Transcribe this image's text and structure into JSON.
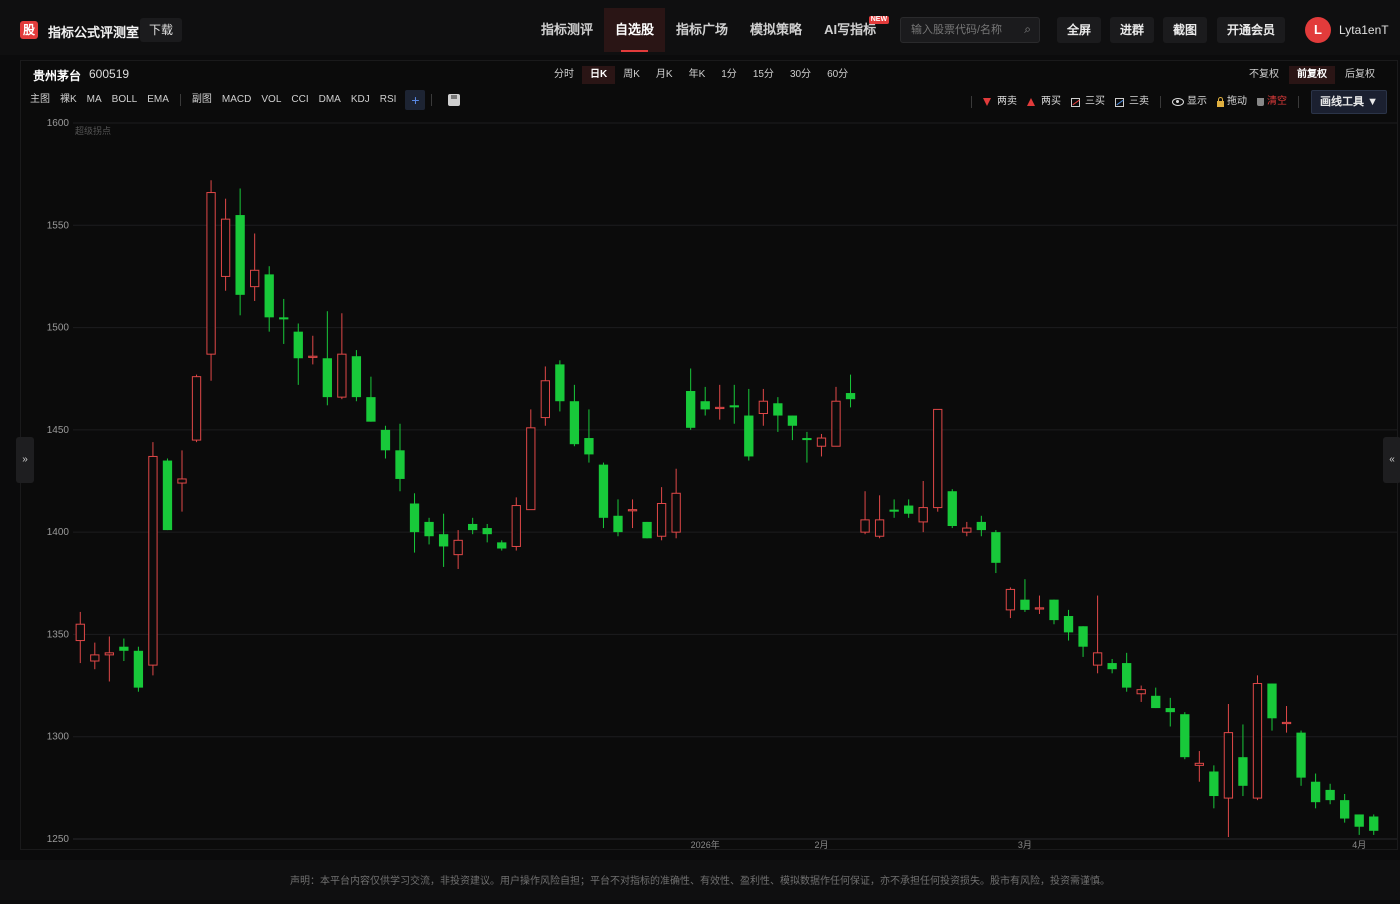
{
  "header": {
    "logo_char": "股",
    "app_title": "指标公式评测室",
    "download_label": "下载",
    "nav": [
      {
        "label": "指标测评",
        "active": false
      },
      {
        "label": "自选股",
        "active": true
      },
      {
        "label": "指标广场",
        "active": false
      },
      {
        "label": "模拟策略",
        "active": false
      },
      {
        "label": "AI写指标",
        "active": false
      }
    ],
    "new_badge": "NEW",
    "search_placeholder": "输入股票代码/名称",
    "buttons": {
      "fullscreen": "全屏",
      "join_group": "进群",
      "screenshot": "截图",
      "vip": "开通会员"
    },
    "user": {
      "avatar_initial": "L",
      "name": "Lyta1enT"
    }
  },
  "stock": {
    "name": "贵州茅台",
    "code": "600519"
  },
  "periods": [
    {
      "label": "分时",
      "active": false
    },
    {
      "label": "日K",
      "active": true
    },
    {
      "label": "周K",
      "active": false
    },
    {
      "label": "月K",
      "active": false
    },
    {
      "label": "年K",
      "active": false
    },
    {
      "label": "1分",
      "active": false
    },
    {
      "label": "15分",
      "active": false
    },
    {
      "label": "30分",
      "active": false
    },
    {
      "label": "60分",
      "active": false
    }
  ],
  "adjust": [
    {
      "label": "不复权",
      "active": false
    },
    {
      "label": "前复权",
      "active": true
    },
    {
      "label": "后复权",
      "active": false
    }
  ],
  "main_indicators": [
    "主图",
    "裸K",
    "MA",
    "BOLL",
    "EMA"
  ],
  "sub_indicators": [
    "副图",
    "MACD",
    "VOL",
    "CCI",
    "DMA",
    "KDJ",
    "RSI"
  ],
  "plus_label": "+",
  "draw_tools": {
    "two_sell": "两卖",
    "two_buy": "两买",
    "three_buy": "三买",
    "three_sell": "三卖",
    "show": "显示",
    "drag": "拖动",
    "clear": "清空",
    "draw_tool_btn": "画线工具 ▼"
  },
  "colors": {
    "up": "#e04848",
    "down": "#18c93a",
    "grid": "#1d1d1f",
    "accent": "#e23b3b"
  },
  "chart_data": {
    "type": "candlestick",
    "annotation": "超级拐点",
    "ylim": [
      1250,
      1600
    ],
    "yticks": [
      1250,
      1300,
      1350,
      1400,
      1450,
      1500,
      1550,
      1600
    ],
    "xlabels": [
      {
        "index": 43,
        "label": "2026年"
      },
      {
        "index": 51,
        "label": "2月"
      },
      {
        "index": 65,
        "label": "3月"
      },
      {
        "index": 88,
        "label": "4月"
      }
    ],
    "candles": [
      [
        1347,
        1355,
        1336,
        1361
      ],
      [
        1337,
        1340,
        1333,
        1346
      ],
      [
        1340,
        1341,
        1327,
        1349
      ],
      [
        1344,
        1342,
        1337,
        1348
      ],
      [
        1342,
        1324,
        1322,
        1344
      ],
      [
        1335,
        1437,
        1330,
        1444
      ],
      [
        1435,
        1401,
        1401,
        1436
      ],
      [
        1424,
        1426,
        1410,
        1440
      ],
      [
        1445,
        1476,
        1444,
        1477
      ],
      [
        1487,
        1566,
        1474,
        1572
      ],
      [
        1525,
        1553,
        1518,
        1563
      ],
      [
        1555,
        1516,
        1506,
        1568
      ],
      [
        1520,
        1528,
        1513,
        1546
      ],
      [
        1526,
        1505,
        1498,
        1530
      ],
      [
        1505,
        1504,
        1492,
        1514
      ],
      [
        1498,
        1485,
        1472,
        1502
      ],
      [
        1486,
        1486,
        1482,
        1496
      ],
      [
        1485,
        1466,
        1462,
        1508
      ],
      [
        1466,
        1487,
        1465,
        1507
      ],
      [
        1486,
        1466,
        1464,
        1489
      ],
      [
        1466,
        1454,
        1454,
        1476
      ],
      [
        1450,
        1440,
        1436,
        1452
      ],
      [
        1440,
        1426,
        1420,
        1453
      ],
      [
        1414,
        1400,
        1390,
        1419
      ],
      [
        1405,
        1398,
        1394,
        1407
      ],
      [
        1399,
        1393,
        1383,
        1409
      ],
      [
        1389,
        1396,
        1382,
        1401
      ],
      [
        1404,
        1401,
        1399,
        1407
      ],
      [
        1402,
        1399,
        1395,
        1404
      ],
      [
        1395,
        1392,
        1391,
        1396
      ],
      [
        1393,
        1413,
        1391,
        1417
      ],
      [
        1411,
        1451,
        1411,
        1460
      ],
      [
        1456,
        1474,
        1452,
        1481
      ],
      [
        1482,
        1464,
        1459,
        1484
      ],
      [
        1464,
        1443,
        1442,
        1472
      ],
      [
        1446,
        1438,
        1434,
        1460
      ],
      [
        1433,
        1407,
        1402,
        1434
      ],
      [
        1408,
        1400,
        1398,
        1416
      ],
      [
        1411,
        1411,
        1402,
        1416
      ],
      [
        1405,
        1397,
        1397,
        1405
      ],
      [
        1398,
        1414,
        1396,
        1422
      ],
      [
        1400,
        1419,
        1397,
        1431
      ],
      [
        1469,
        1451,
        1450,
        1480
      ],
      [
        1464,
        1460,
        1457,
        1471
      ],
      [
        1461,
        1461,
        1455,
        1472
      ],
      [
        1462,
        1461,
        1453,
        1472
      ],
      [
        1457,
        1437,
        1435,
        1470
      ],
      [
        1458,
        1464,
        1452,
        1470
      ],
      [
        1463,
        1457,
        1449,
        1466
      ],
      [
        1457,
        1452,
        1445,
        1457
      ],
      [
        1446,
        1445,
        1434,
        1449
      ],
      [
        1442,
        1446,
        1437,
        1448
      ],
      [
        1442,
        1464,
        1442,
        1471
      ],
      [
        1468,
        1465,
        1461,
        1477
      ],
      [
        1400,
        1406,
        1399,
        1420
      ],
      [
        1398,
        1406,
        1397,
        1418
      ],
      [
        1411,
        1410,
        1407,
        1416
      ],
      [
        1413,
        1409,
        1407,
        1416
      ],
      [
        1405,
        1412,
        1400,
        1425
      ],
      [
        1412,
        1460,
        1410,
        1460
      ],
      [
        1420,
        1403,
        1402,
        1421
      ],
      [
        1400,
        1402,
        1398,
        1405
      ],
      [
        1405,
        1401,
        1398,
        1408
      ],
      [
        1400,
        1385,
        1380,
        1401
      ],
      [
        1362,
        1372,
        1358,
        1373
      ],
      [
        1367,
        1362,
        1361,
        1377
      ],
      [
        1363,
        1363,
        1360,
        1369
      ],
      [
        1367,
        1357,
        1355,
        1367
      ],
      [
        1359,
        1351,
        1347,
        1362
      ],
      [
        1354,
        1344,
        1339,
        1354
      ],
      [
        1335,
        1341,
        1331,
        1369
      ],
      [
        1336,
        1333,
        1331,
        1338
      ],
      [
        1336,
        1324,
        1322,
        1341
      ],
      [
        1321,
        1323,
        1317,
        1325
      ],
      [
        1320,
        1314,
        1314,
        1324
      ],
      [
        1314,
        1312,
        1305,
        1319
      ],
      [
        1311,
        1290,
        1289,
        1312
      ],
      [
        1286,
        1287,
        1278,
        1293
      ],
      [
        1283,
        1271,
        1265,
        1286
      ],
      [
        1270,
        1302,
        1251,
        1316
      ],
      [
        1290,
        1276,
        1271,
        1306
      ],
      [
        1270,
        1326,
        1269,
        1330
      ],
      [
        1326,
        1309,
        1303,
        1326
      ],
      [
        1307,
        1307,
        1302,
        1315
      ],
      [
        1302,
        1280,
        1276,
        1303
      ],
      [
        1278,
        1268,
        1265,
        1282
      ],
      [
        1274,
        1269,
        1267,
        1277
      ],
      [
        1269,
        1260,
        1258,
        1272
      ],
      [
        1262,
        1256,
        1252,
        1262
      ],
      [
        1261,
        1254,
        1252,
        1262
      ]
    ]
  }
}
